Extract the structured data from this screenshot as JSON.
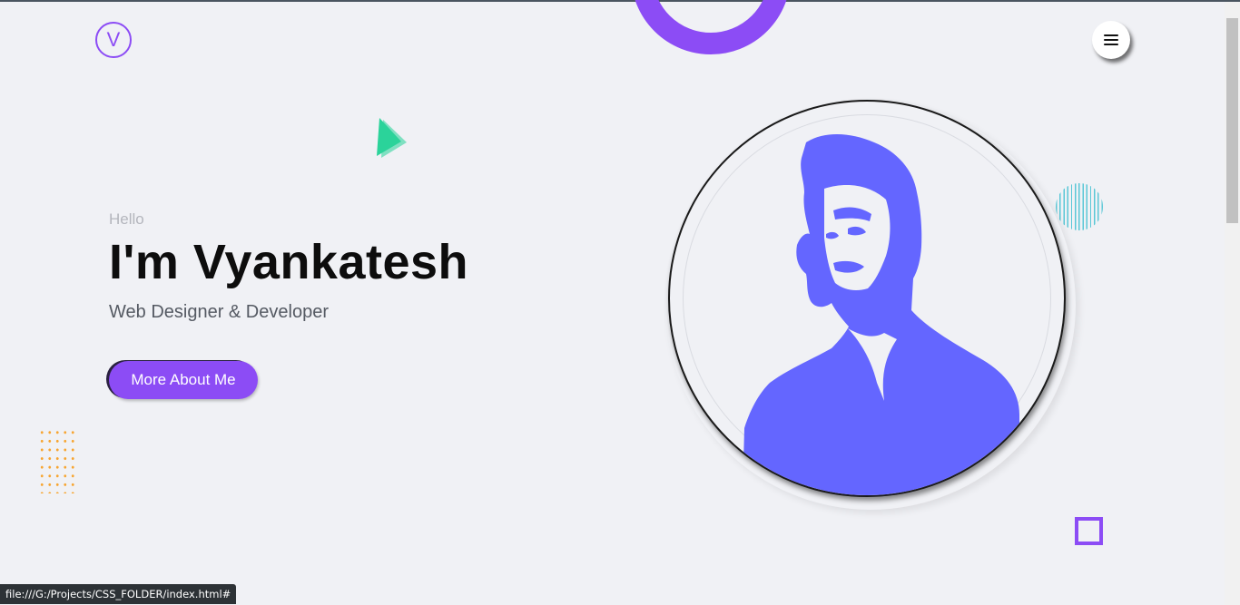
{
  "header": {
    "logo_letter": "V"
  },
  "hero": {
    "greeting": "Hello",
    "name": "I'm Vyankatesh",
    "role": "Web Designer & Developer",
    "cta_label": "More About Me"
  },
  "colors": {
    "accent": "#8c4cf5",
    "portrait": "#6466ff",
    "triangle": "#2bd39a",
    "dots": "#f7a531",
    "stripes": "#5ac7d6",
    "background": "#f0f1f5"
  },
  "icons": {
    "menu": "hamburger-icon",
    "portrait": "portrait-silhouette"
  },
  "status_bar": {
    "url": "file:///G:/Projects/CSS_FOLDER/index.html#"
  }
}
